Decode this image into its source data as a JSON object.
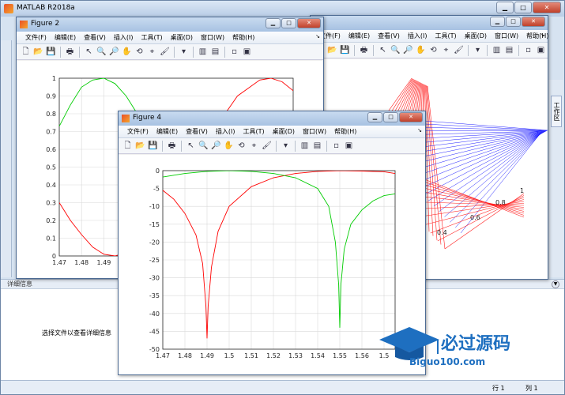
{
  "app": {
    "title": "MATLAB R2018a"
  },
  "detail_panel": {
    "header": "详细信息",
    "hint": "选择文件以查看详细信息"
  },
  "right_tab": {
    "label": "工作区"
  },
  "status": {
    "row_label": "行",
    "row_value": "1",
    "col_label": "列",
    "col_value": "1"
  },
  "figure_menu": [
    "文件(F)",
    "编辑(E)",
    "查看(V)",
    "插入(I)",
    "工具(T)",
    "桌面(D)",
    "窗口(W)",
    "帮助(H)"
  ],
  "toolbar_icons": [
    "new-file-icon",
    "open-folder-icon",
    "save-icon",
    "print-icon",
    "pointer-icon",
    "zoom-in-icon",
    "zoom-out-icon",
    "pan-icon",
    "rotate-icon",
    "data-cursor-icon",
    "brush-icon",
    "link-icon",
    "colorbar-icon",
    "legend-icon",
    "hide-plot-tools-icon",
    "show-plot-tools-icon"
  ],
  "figures": {
    "fig2": {
      "title": "Figure 2"
    },
    "fig3": {
      "title": ""
    },
    "fig4": {
      "title": "Figure 4"
    }
  },
  "watermark": {
    "logo_text": "必过源码",
    "url": "Biguo100.com"
  },
  "chart_data": [
    {
      "type": "line",
      "figure": "Figure 2",
      "title": "",
      "xlabel": "",
      "ylabel": "",
      "xlim": [
        1.47,
        1.575
      ],
      "ylim": [
        0,
        1
      ],
      "xticks": [
        "1.47",
        "1.48",
        "1.49"
      ],
      "yticks": [
        "0",
        "0.1",
        "0.2",
        "0.3",
        "0.4",
        "0.5",
        "0.6",
        "0.7",
        "0.8",
        "0.9",
        "1"
      ],
      "grid": true,
      "series": [
        {
          "color": "#00cc00",
          "x": [
            1.47,
            1.475,
            1.48,
            1.485,
            1.49,
            1.495,
            1.5,
            1.505,
            1.51
          ],
          "y": [
            0.73,
            0.85,
            0.95,
            0.99,
            1.0,
            0.97,
            0.9,
            0.8,
            0.68
          ]
        },
        {
          "color": "#ff0000",
          "x": [
            1.47,
            1.475,
            1.48,
            1.485,
            1.49,
            1.495,
            1.5
          ],
          "y": [
            0.3,
            0.2,
            0.12,
            0.05,
            0.01,
            0.0,
            0.02
          ]
        },
        {
          "color": "#ff0000",
          "x": [
            1.53,
            1.54,
            1.55,
            1.56,
            1.565,
            1.57,
            1.575
          ],
          "y": [
            0.45,
            0.72,
            0.9,
            0.99,
            1.0,
            0.98,
            0.93
          ]
        }
      ]
    },
    {
      "type": "line",
      "figure": "Figure 4",
      "title": "",
      "xlabel": "",
      "ylabel": "",
      "xlim": [
        1.47,
        1.575
      ],
      "ylim": [
        -50,
        0
      ],
      "xticks": [
        "1.47",
        "1.48",
        "1.49",
        "1.5",
        "1.51",
        "1.52",
        "1.53",
        "1.54",
        "1.55",
        "1.56",
        "1.5"
      ],
      "yticks": [
        "0",
        "-5",
        "-10",
        "-15",
        "-20",
        "-25",
        "-30",
        "-35",
        "-40",
        "-45",
        "-50"
      ],
      "grid": true,
      "series": [
        {
          "color": "#ff0000",
          "x": [
            1.47,
            1.475,
            1.48,
            1.485,
            1.488,
            1.4895,
            1.49,
            1.4905,
            1.492,
            1.495,
            1.5,
            1.51,
            1.52,
            1.53,
            1.54,
            1.55,
            1.56,
            1.57,
            1.575
          ],
          "y": [
            -5.5,
            -8,
            -12,
            -18,
            -26,
            -38,
            -47,
            -38,
            -27,
            -17,
            -10,
            -4.5,
            -2,
            -0.8,
            -0.2,
            0,
            -0.1,
            -0.3,
            -0.8
          ]
        },
        {
          "color": "#00cc00",
          "x": [
            1.47,
            1.48,
            1.49,
            1.5,
            1.51,
            1.52,
            1.53,
            1.54,
            1.545,
            1.548,
            1.5495,
            1.55,
            1.5505,
            1.552,
            1.555,
            1.56,
            1.565,
            1.57,
            1.575
          ],
          "y": [
            -1.8,
            -0.8,
            -0.2,
            0,
            -0.2,
            -0.8,
            -2,
            -5,
            -10,
            -20,
            -32,
            -44,
            -32,
            -22,
            -15,
            -11,
            -8.5,
            -7,
            -6.5
          ]
        }
      ]
    }
  ]
}
